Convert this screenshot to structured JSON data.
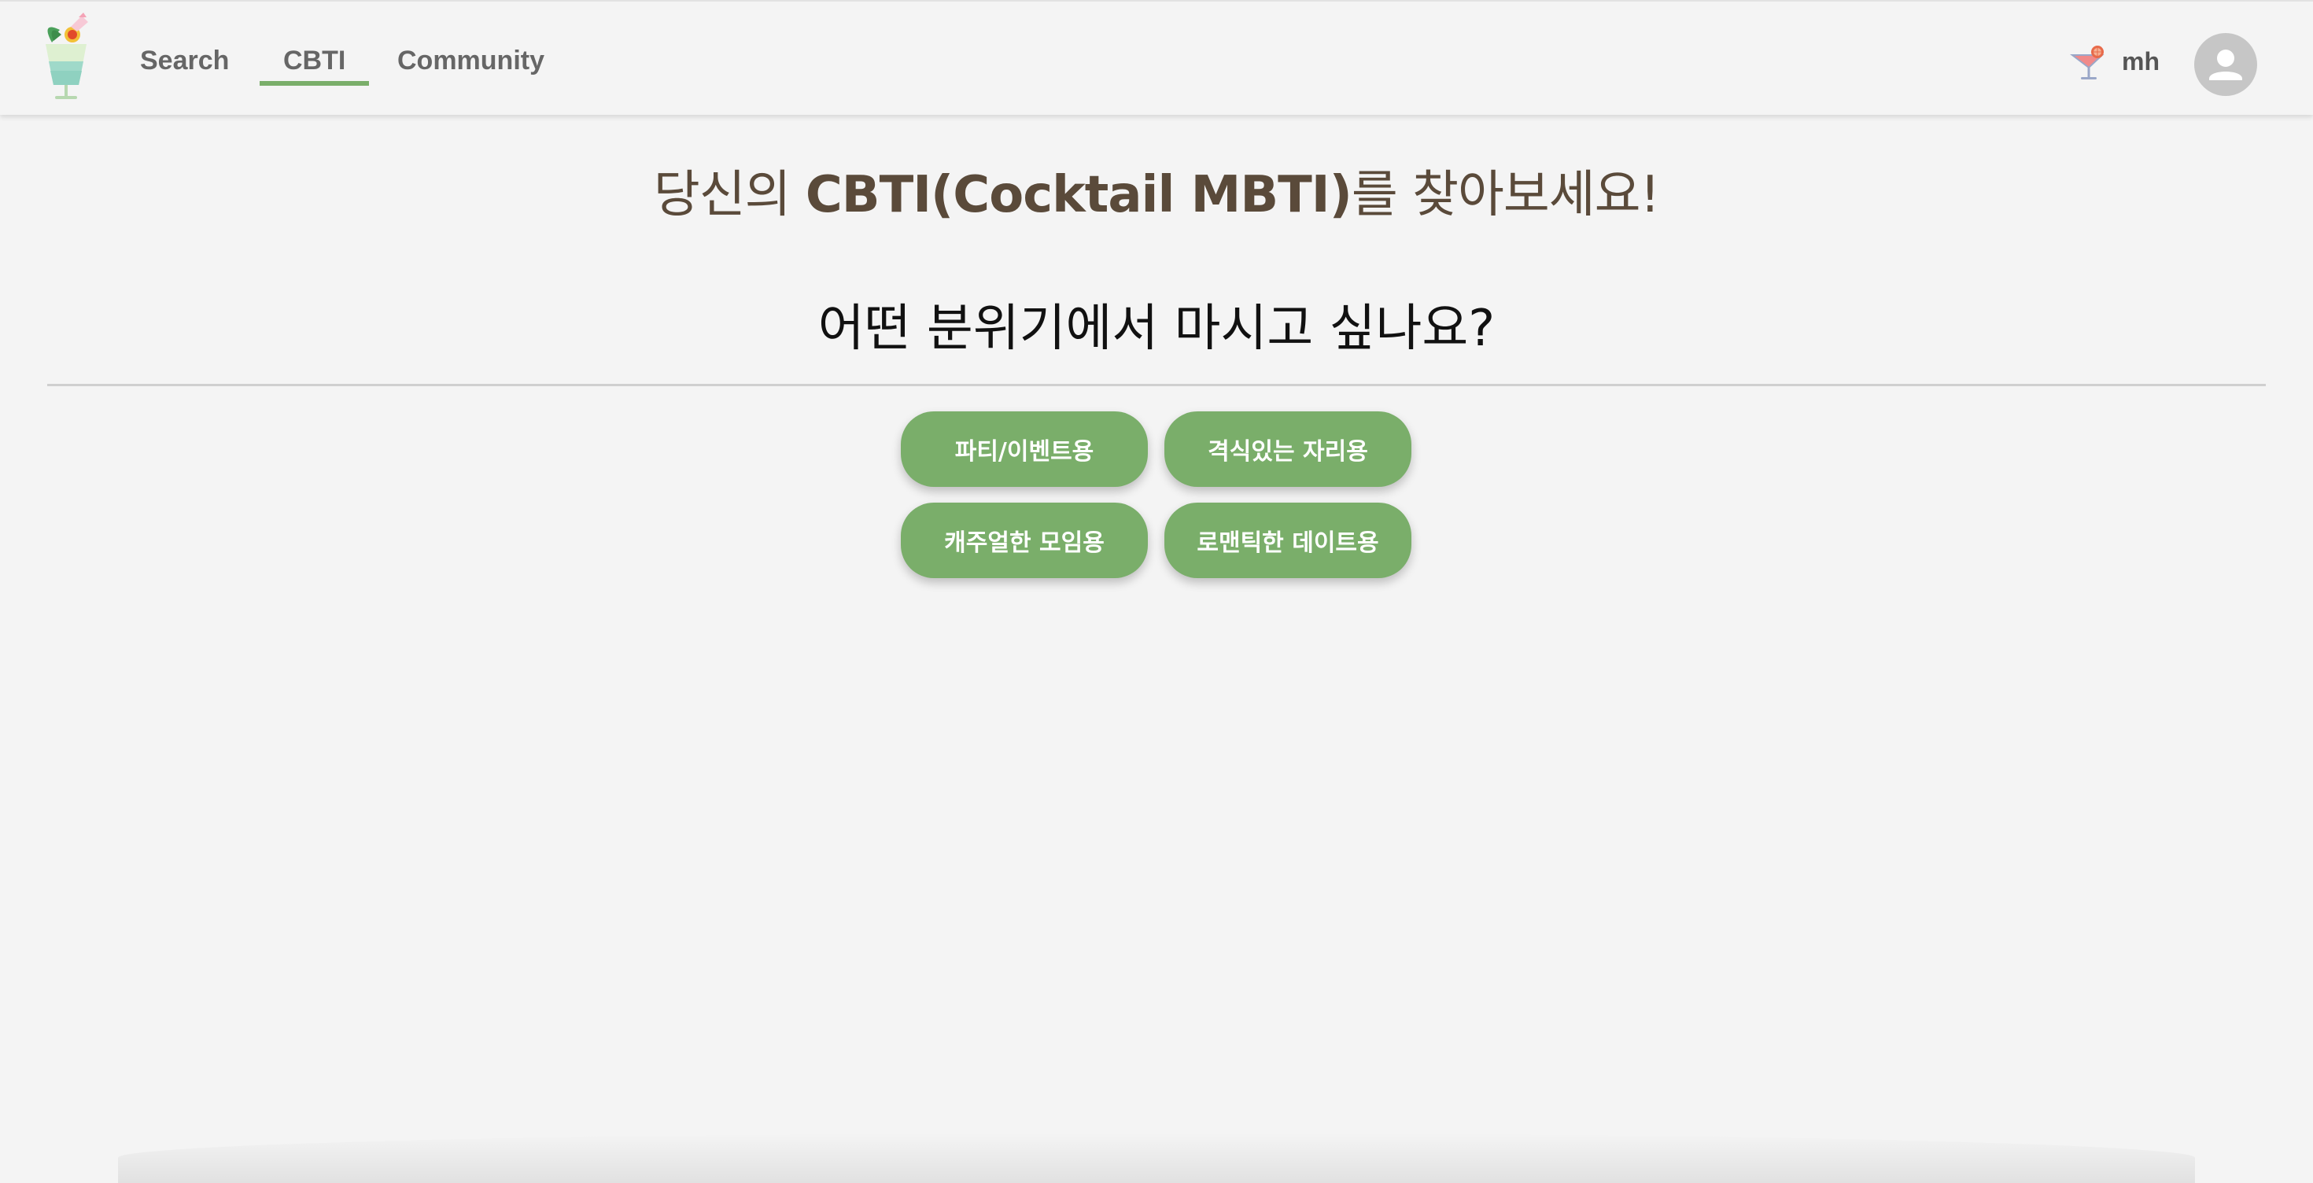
{
  "nav": {
    "items": [
      {
        "label": "Search"
      },
      {
        "label": "CBTI"
      },
      {
        "label": "Community"
      }
    ],
    "active": "CBTI"
  },
  "user": {
    "name": "mh"
  },
  "main": {
    "title_pre": "당신의 ",
    "title_bold": "CBTI(Cocktail MBTI)",
    "title_post": "를 찾아보세요!",
    "question": "어떤 분위기에서 마시고 싶나요?",
    "options": [
      {
        "label": "파티/이벤트용"
      },
      {
        "label": "격식있는 자리용"
      },
      {
        "label": "캐주얼한 모임용"
      },
      {
        "label": "로맨틱한 데이트용"
      }
    ]
  },
  "colors": {
    "accent": "#7aae6a",
    "title": "#5a4a3a",
    "background": "#f4f4f4"
  },
  "icons": [
    "cocktail-logo-icon",
    "cocktail-glass-icon",
    "user-avatar-icon"
  ]
}
